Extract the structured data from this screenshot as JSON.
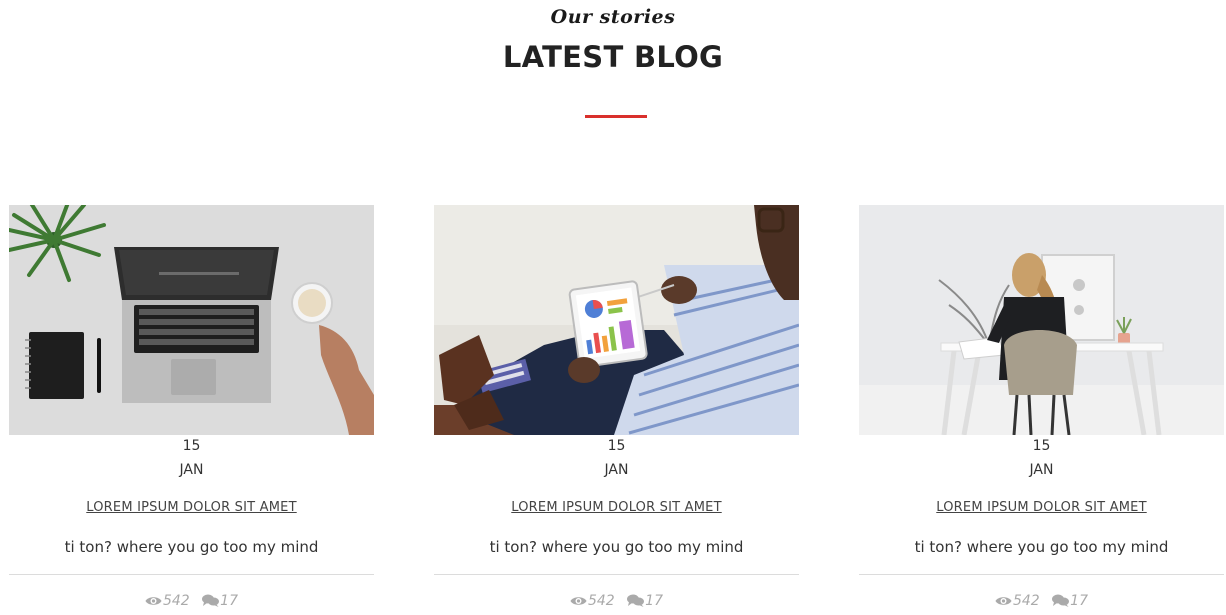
{
  "header": {
    "subtitle": "Our stories",
    "title": "LATEST BLOG",
    "accent_color": "#d9302c"
  },
  "posts": [
    {
      "image": "laptop-coffee-desk-photo",
      "day": "15",
      "month": "JAN",
      "title": "LOREM IPSUM DOLOR SIT AMET",
      "excerpt": "ti ton? where you go too my mind",
      "views": "542",
      "comments": "17",
      "views_icon": "eye-icon",
      "comments_icon": "comments-icon"
    },
    {
      "image": "man-tablet-chart-photo",
      "day": "15",
      "month": "JAN",
      "title": "LOREM IPSUM DOLOR SIT AMET",
      "excerpt": "ti ton? where you go too my mind",
      "views": "542",
      "comments": "17",
      "views_icon": "eye-icon",
      "comments_icon": "comments-icon"
    },
    {
      "image": "woman-desk-workspace-photo",
      "day": "15",
      "month": "JAN",
      "title": "LOREM IPSUM DOLOR SIT AMET",
      "excerpt": "ti ton? where you go too my mind",
      "views": "542",
      "comments": "17",
      "views_icon": "eye-icon",
      "comments_icon": "comments-icon"
    }
  ]
}
